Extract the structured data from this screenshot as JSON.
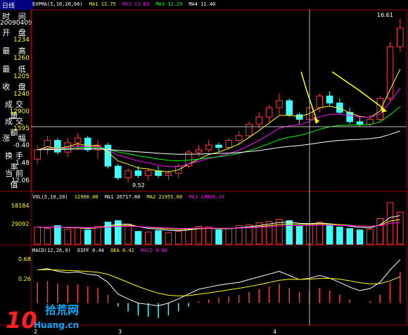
{
  "window": {
    "title": "日线"
  },
  "info_panel": {
    "time_label": "时 间",
    "time_value": "20090409",
    "open_label": "开 盘",
    "open_value": "1234",
    "high_label": "最 高",
    "high_value": "1260",
    "low_label": "最 低",
    "low_value": "1205",
    "close_label": "收 盘",
    "close_value": "1240",
    "volume_label": "成交量",
    "volume_value": "12900",
    "amount_label": "成交额",
    "amount_value": "1595",
    "change_label": "涨 幅",
    "change_value": "-0.40",
    "turnover_label": "换手率",
    "turnover_value": "1.48",
    "current_label": "当前值",
    "current_value": "12.06"
  },
  "price_legend": {
    "name": "EXPMA(5,10,20,60)",
    "ma1": "MA1 12.75",
    "ma2": "MA2 12.63",
    "ma3": "MA3 12.29",
    "ma4": "MA4 11.40"
  },
  "vol_legend": {
    "name": "VOL(5,10,20)",
    "value": "12900.00",
    "ma1": "MA1 26717.80",
    "ma2": "MA2 21955.00",
    "ma3": "MA3 19868.30"
  },
  "macd_legend": {
    "name": "MACD(12,26,9)",
    "diff": "DIFF 0.44",
    "dea": "DEA 0.41",
    "macd": "MACD 0.06"
  },
  "annotations": {
    "high_price": "16.61",
    "low_price": "9.52"
  },
  "vol_axis": {
    "top": "58184",
    "mid": "29092"
  },
  "macd_axis": {
    "top": "0.68",
    "mid": "0.26"
  },
  "date_axis": {
    "d1": "2",
    "d2": "3",
    "d3": "4"
  },
  "watermark": {
    "text": "拾荒网",
    "url": "Huang.cn"
  },
  "colors": {
    "up": "#ff3c3c",
    "down": "#40ffff",
    "ma1": "#ffffff",
    "ma2": "#ffff00",
    "ma3": "#ff00ff",
    "ma4": "#00ff00",
    "grid": "#a00000"
  },
  "chart_data": {
    "type": "candlestick",
    "candles": [
      [
        10.6,
        11.2,
        10.4,
        11.0
      ],
      [
        11.0,
        11.6,
        10.8,
        11.4
      ],
      [
        11.4,
        11.5,
        10.8,
        10.9
      ],
      [
        10.9,
        11.5,
        10.7,
        11.3
      ],
      [
        11.3,
        11.7,
        11.0,
        11.5
      ],
      [
        11.5,
        11.6,
        10.9,
        11.0
      ],
      [
        11.0,
        11.4,
        10.6,
        11.2
      ],
      [
        11.2,
        11.3,
        10.2,
        10.3
      ],
      [
        10.3,
        10.4,
        9.7,
        9.8
      ],
      [
        9.8,
        10.2,
        9.6,
        10.1
      ],
      [
        10.1,
        10.3,
        9.8,
        9.9
      ],
      [
        9.9,
        10.2,
        9.7,
        10.1
      ],
      [
        10.1,
        10.3,
        9.8,
        9.9
      ],
      [
        9.9,
        10.1,
        9.7,
        10.0
      ],
      [
        10.0,
        10.4,
        9.8,
        10.3
      ],
      [
        10.3,
        11.0,
        10.2,
        10.9
      ],
      [
        10.9,
        11.2,
        10.7,
        11.0
      ],
      [
        11.0,
        11.4,
        10.9,
        11.2
      ],
      [
        11.2,
        11.3,
        10.9,
        11.1
      ],
      [
        11.1,
        11.5,
        11.0,
        11.4
      ],
      [
        11.4,
        11.8,
        11.2,
        11.6
      ],
      [
        11.6,
        12.2,
        11.5,
        12.1
      ],
      [
        12.1,
        12.6,
        11.9,
        12.4
      ],
      [
        12.4,
        12.9,
        12.2,
        12.8
      ],
      [
        12.8,
        13.4,
        12.5,
        13.1
      ],
      [
        13.1,
        13.2,
        12.4,
        12.5
      ],
      [
        12.5,
        12.6,
        12.1,
        12.3
      ],
      [
        12.3,
        12.9,
        12.2,
        12.8
      ],
      [
        12.8,
        13.4,
        12.6,
        13.3
      ],
      [
        13.3,
        13.5,
        12.9,
        13.0
      ],
      [
        13.0,
        13.2,
        12.5,
        12.6
      ],
      [
        12.6,
        12.8,
        12.1,
        12.2
      ],
      [
        12.2,
        12.4,
        12.0,
        12.1
      ],
      [
        12.1,
        12.5,
        12.0,
        12.3
      ],
      [
        12.3,
        13.3,
        12.2,
        13.2
      ],
      [
        13.2,
        15.6,
        13.1,
        15.4
      ],
      [
        15.4,
        16.61,
        15.2,
        16.2
      ]
    ],
    "volume": [
      24000,
      22000,
      26000,
      21000,
      23000,
      20000,
      25000,
      31000,
      33000,
      28000,
      18000,
      17000,
      19000,
      16000,
      18000,
      22000,
      25000,
      24000,
      20000,
      22000,
      26000,
      27000,
      30000,
      32000,
      35000,
      33000,
      25000,
      28000,
      31000,
      27000,
      24000,
      22000,
      20000,
      21000,
      36000,
      58184,
      45000
    ],
    "macd": [
      0.3,
      0.32,
      0.28,
      0.26,
      0.27,
      0.24,
      0.22,
      0.12,
      -0.05,
      -0.12,
      -0.18,
      -0.2,
      -0.22,
      -0.18,
      -0.12,
      -0.05,
      0.02,
      0.05,
      0.08,
      0.1,
      0.12,
      0.16,
      0.2,
      0.24,
      0.28,
      0.22,
      0.16,
      0.18,
      0.22,
      0.18,
      0.12,
      0.05,
      0.0,
      0.03,
      0.12,
      0.3,
      0.45
    ]
  }
}
